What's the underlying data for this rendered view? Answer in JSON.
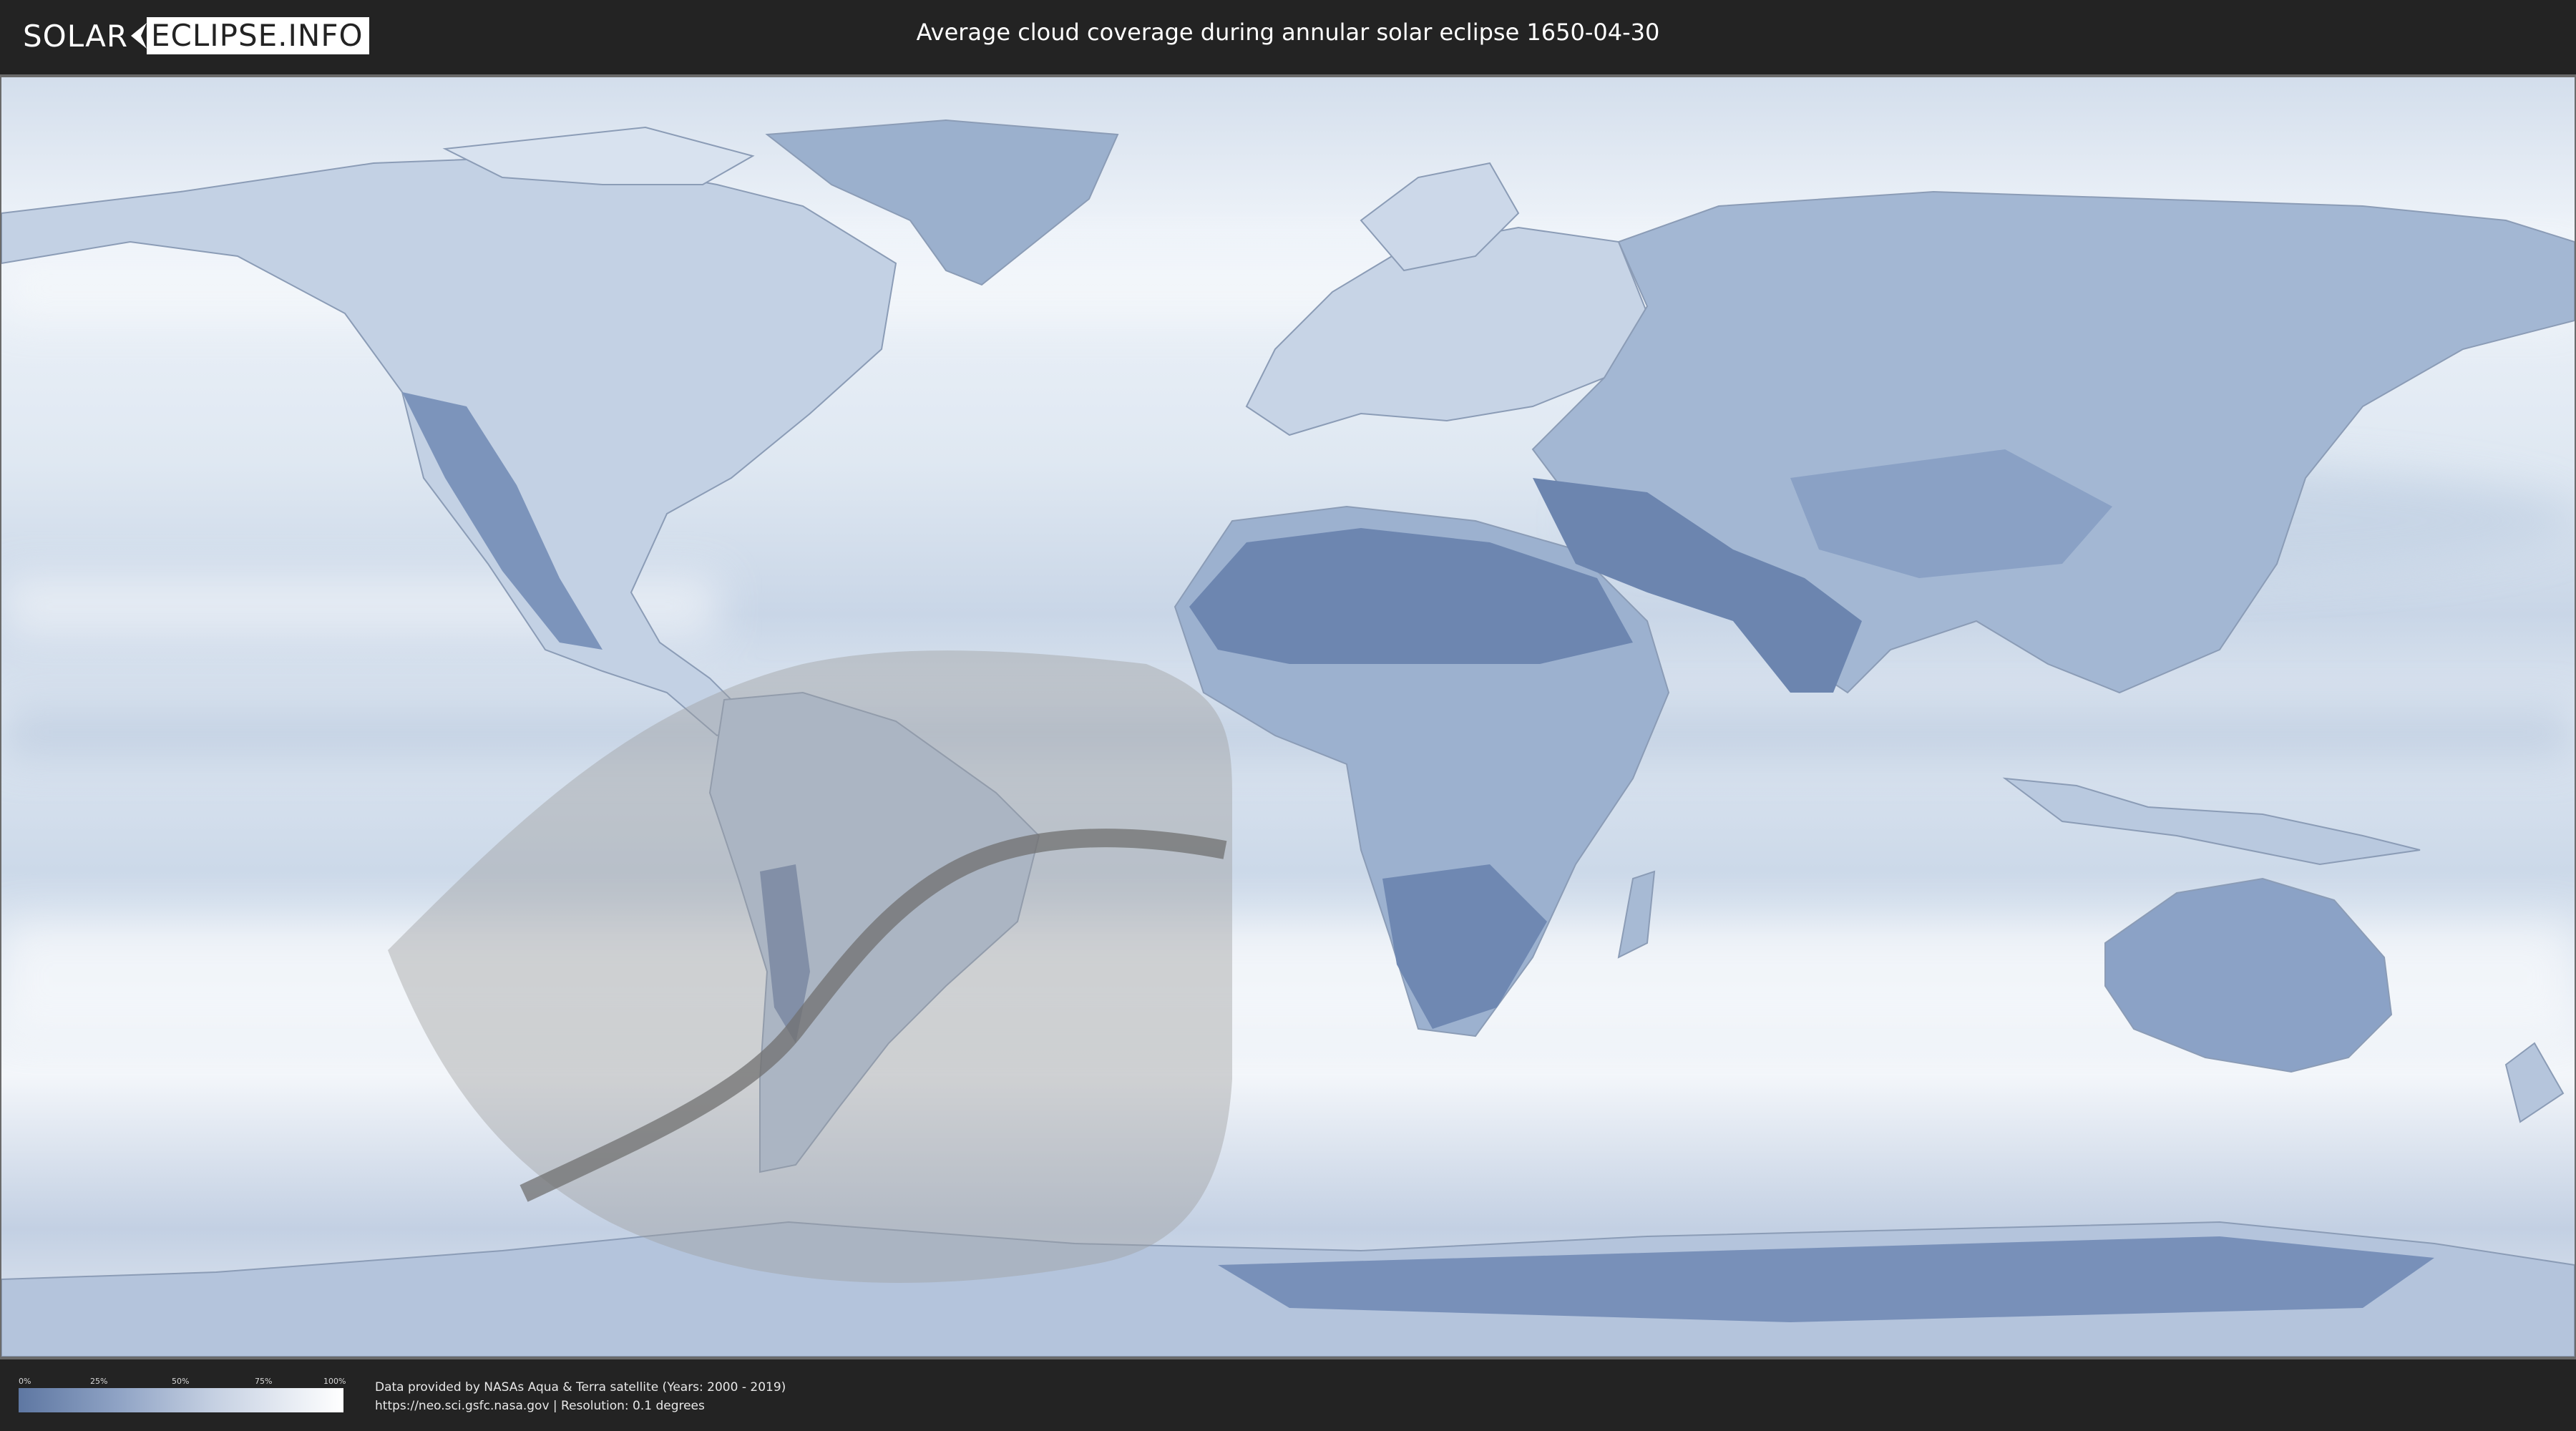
{
  "header": {
    "logo_left": "SOLAR",
    "logo_right": "ECLIPSE.INFO",
    "title": "Average cloud coverage during annular solar eclipse 1650-04-30"
  },
  "legend": {
    "ticks": [
      "0%",
      "25%",
      "50%",
      "75%",
      "100%"
    ],
    "gradient_colors": [
      "#5e77a2",
      "#8ea2c4",
      "#c5d0e2",
      "#ffffff"
    ]
  },
  "footer": {
    "credit_line1": "Data provided by NASAs Aqua & Terra satellite (Years: 2000 - 2019)",
    "credit_line2": "https://neo.sci.gsfc.nasa.gov | Resolution: 0.1 degrees"
  },
  "map": {
    "projection": "equirectangular world map",
    "ocean_color": "#e4ecf5",
    "land_cloud_color": "#6f88b1",
    "eclipse_overlay_color": "#b0b0b0",
    "central_path_color": "#6b6b6b"
  }
}
